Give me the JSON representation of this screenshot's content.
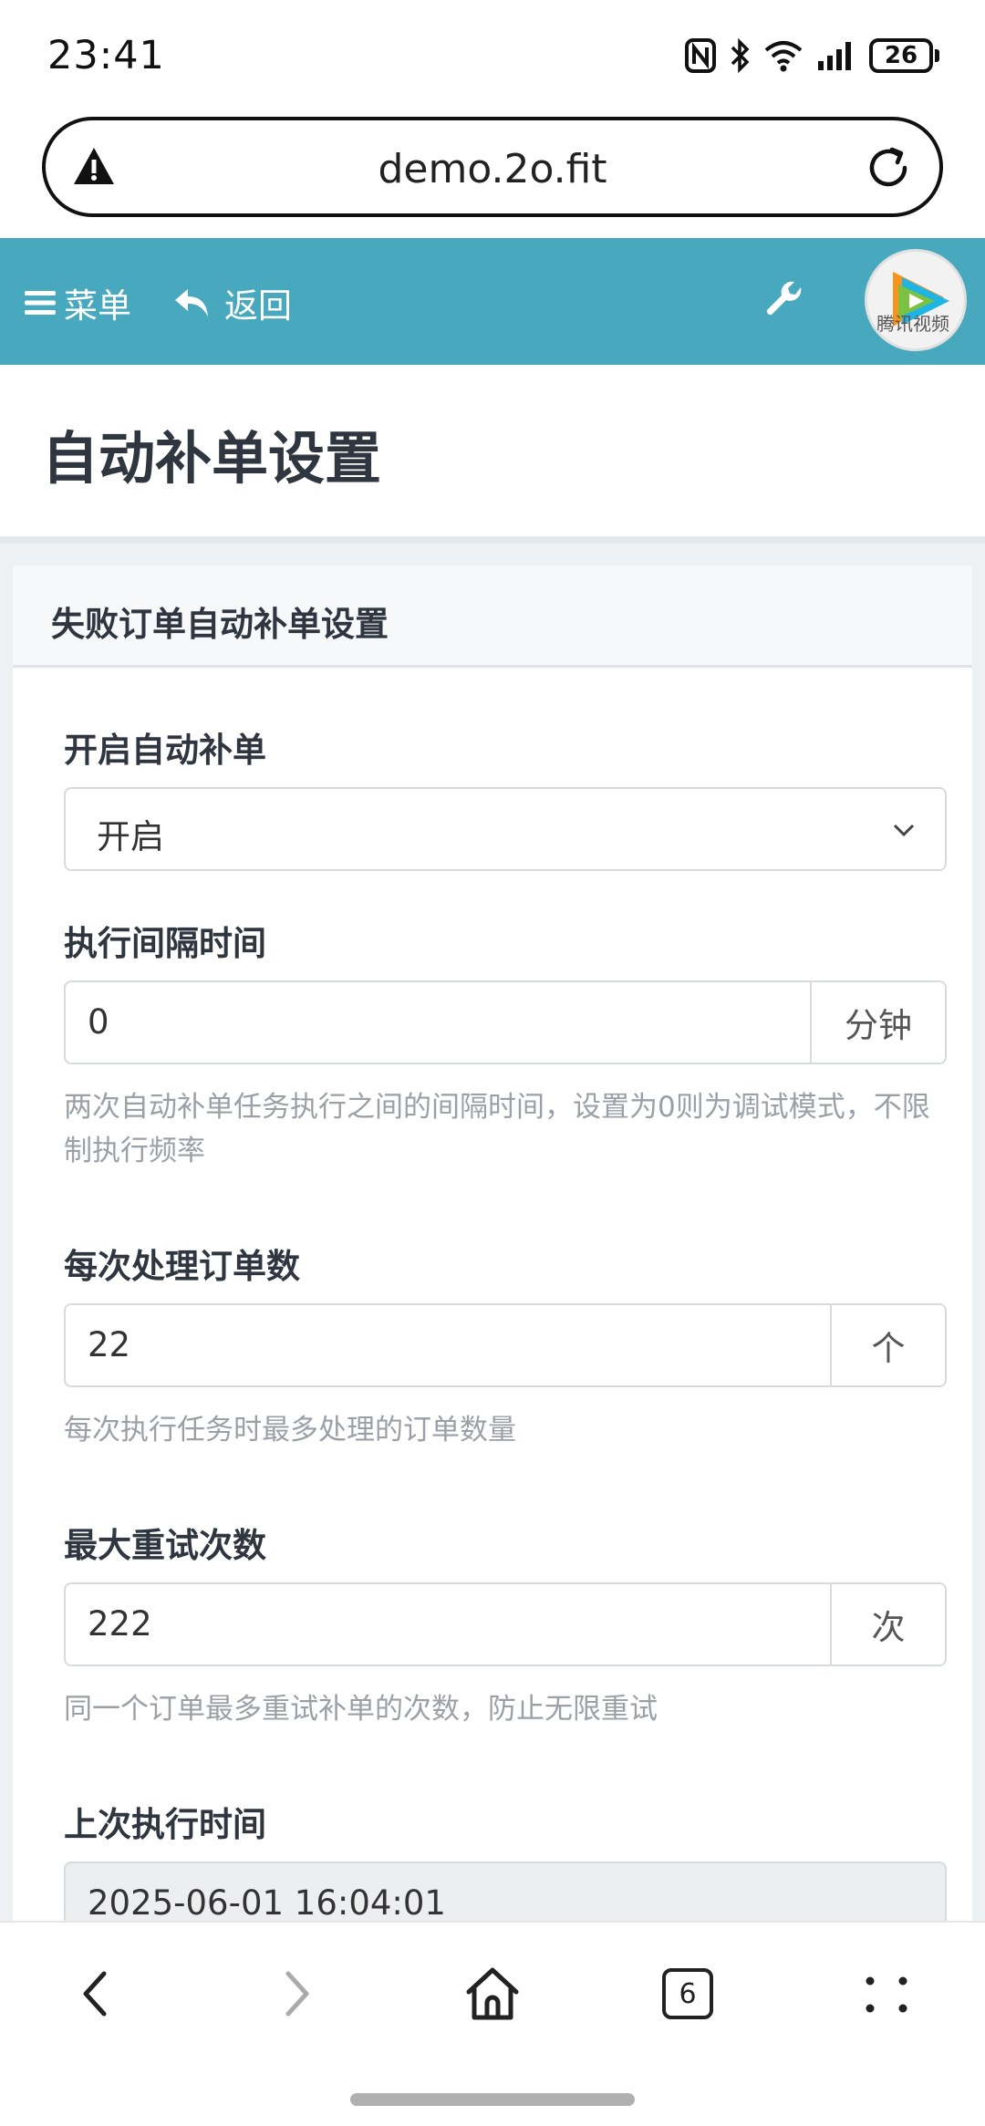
{
  "status_bar": {
    "time": "23:41",
    "battery": "26",
    "icons": [
      "nfc-icon",
      "bluetooth-icon",
      "wifi-icon",
      "signal-icon",
      "battery-icon"
    ]
  },
  "browser": {
    "url": "demo.2o.fit",
    "tab_count": "6"
  },
  "navbar": {
    "menu_label": "菜单",
    "back_label": "返回",
    "avatar_text": "腾讯视频",
    "bg_color": "#48a8bd"
  },
  "page": {
    "title": "自动补单设置"
  },
  "card": {
    "header": "失败订单自动补单设置",
    "fields": {
      "enable": {
        "label": "开启自动补单",
        "value": "开启"
      },
      "interval": {
        "label": "执行间隔时间",
        "value": "0",
        "unit": "分钟",
        "help": "两次自动补单任务执行之间的间隔时间，设置为0则为调试模式，不限制执行频率"
      },
      "batch": {
        "label": "每次处理订单数",
        "value": "22",
        "unit": "个",
        "help": "每次执行任务时最多处理的订单数量"
      },
      "retries": {
        "label": "最大重试次数",
        "value": "222",
        "unit": "次",
        "help": "同一个订单最多重试补单的次数，防止无限重试"
      },
      "last_run": {
        "label": "上次执行时间",
        "value": "2025-06-01 16:04:01"
      }
    }
  }
}
